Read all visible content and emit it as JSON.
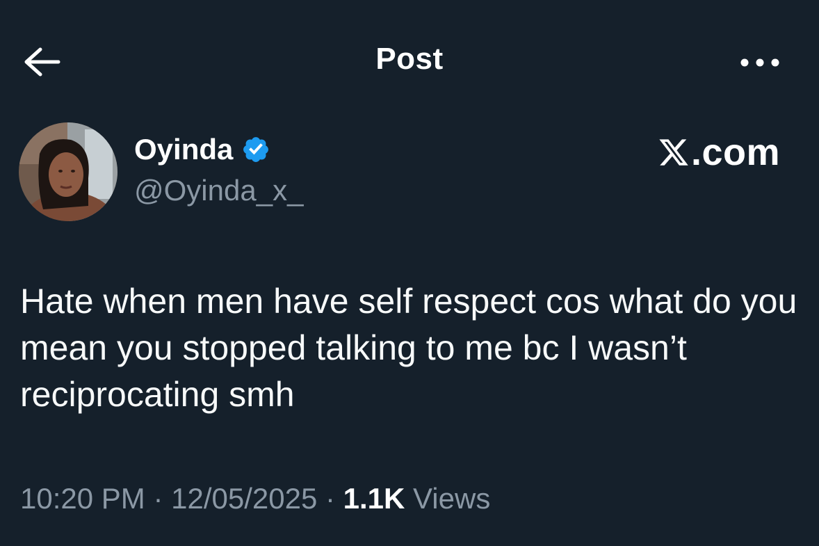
{
  "header": {
    "title": "Post"
  },
  "author": {
    "display_name": "Oyinda",
    "handle": "@Oyinda_x_",
    "verified": true
  },
  "site_label": {
    "prefix_icon": "x-logo-icon",
    "text": ".com"
  },
  "post": {
    "text": "Hate when men have self respect cos what do you mean you stopped talking to me bc I wasn’t reciprocating smh"
  },
  "meta": {
    "time": "10:20 PM",
    "separator": " · ",
    "date": "12/05/2025",
    "views_count": "1.1K",
    "views_label": " Views"
  },
  "colors": {
    "background": "#15202b",
    "text_primary": "#ffffff",
    "text_secondary": "#8b98a5",
    "verified_blue": "#1d9bf0"
  }
}
